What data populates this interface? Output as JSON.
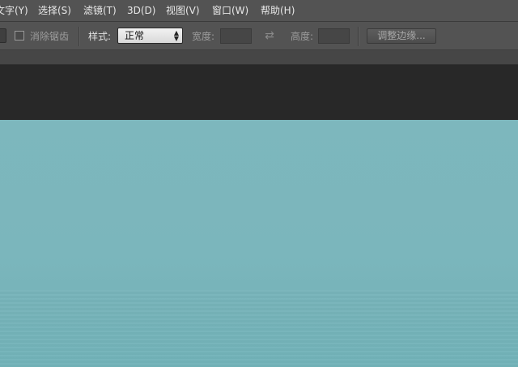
{
  "menubar": {
    "items": [
      "文字(Y)",
      "选择(S)",
      "滤镜(T)",
      "3D(D)",
      "视图(V)",
      "窗口(W)",
      "帮助(H)"
    ]
  },
  "options": {
    "antialias_label": "消除锯齿",
    "style_label": "样式:",
    "style_value": "正常",
    "width_label": "宽度:",
    "height_label": "高度:",
    "refine_edge_button": "调整边缘..."
  },
  "colors": {
    "canvas": "#7bb6bc",
    "menubar": "#535353",
    "document_bg": "#282828"
  },
  "icons": {
    "style_dropdown": "updown-caret-icon",
    "swap": "swap-arrows-icon"
  }
}
